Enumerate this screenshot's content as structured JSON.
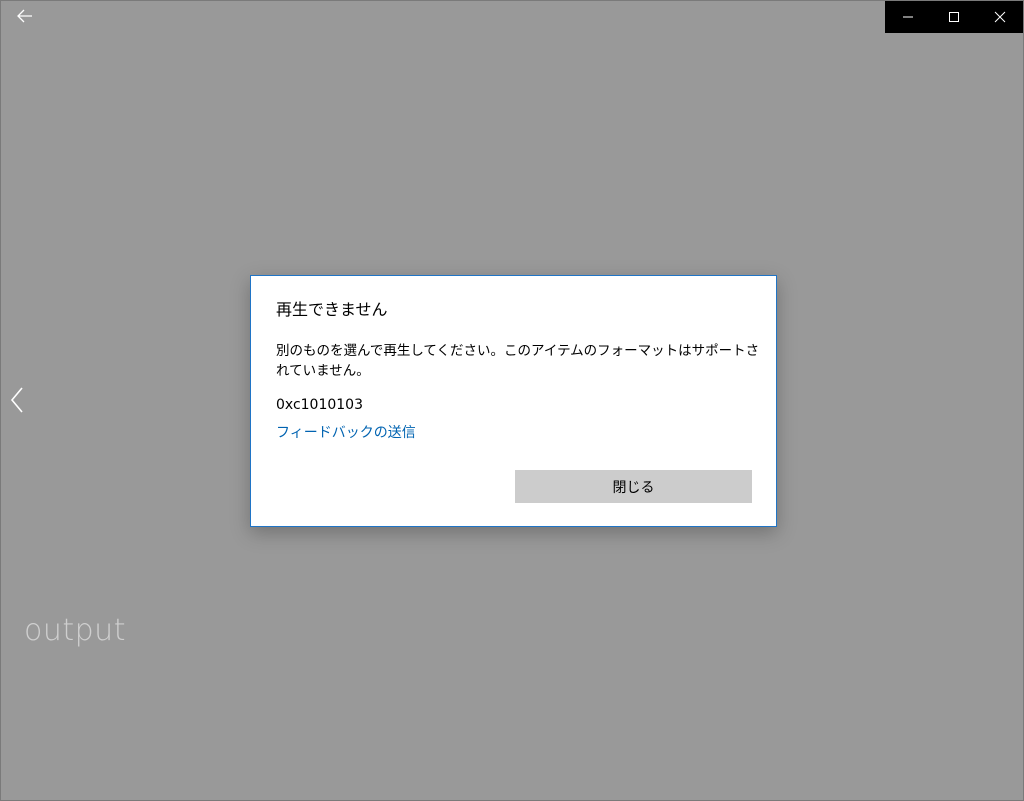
{
  "titlebar": {
    "back_icon": "back-arrow-icon",
    "controls": {
      "minimize_icon": "minimize-icon",
      "maximize_icon": "maximize-icon",
      "close_icon": "close-icon",
      "background": "#000000"
    }
  },
  "player": {
    "background": "#999999",
    "prev_icon": "chevron-left-icon",
    "media_title": "output"
  },
  "dialog": {
    "title": "再生できません",
    "message": "別のものを選んで再生してください。このアイテムのフォーマットはサポートされていません。",
    "error_code": "0xc1010103",
    "feedback_link": "フィードバックの送信",
    "close_label": "閉じる",
    "accent_color": "#1f74c6",
    "link_color": "#0063b1"
  }
}
